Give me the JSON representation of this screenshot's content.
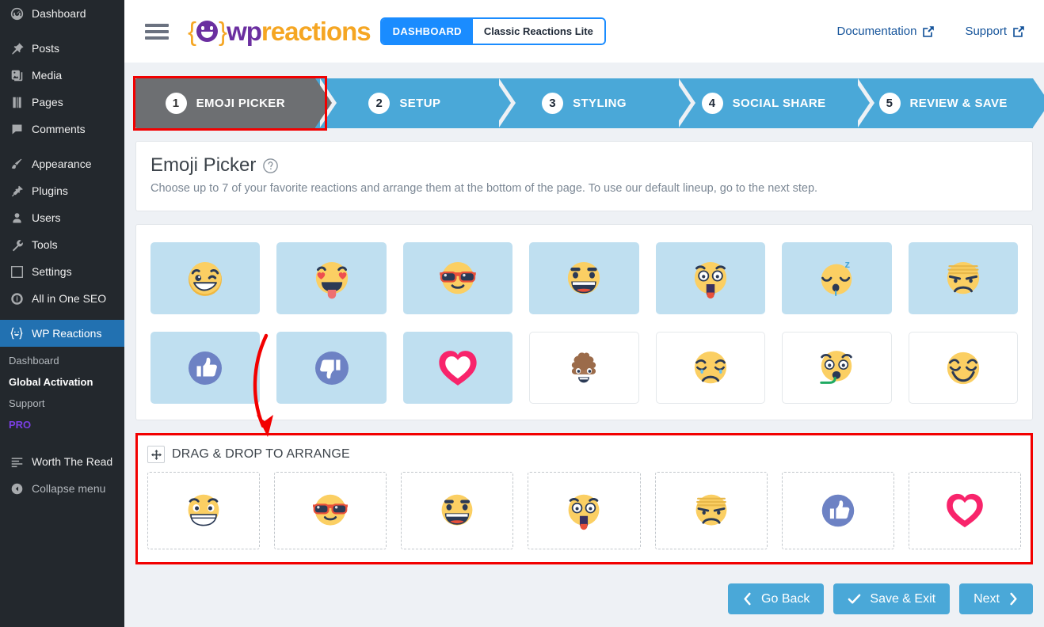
{
  "sidebar": {
    "items": [
      {
        "label": "Dashboard",
        "icon": "dashboard-icon"
      },
      {
        "label": "Posts",
        "icon": "pin-icon"
      },
      {
        "label": "Media",
        "icon": "media-icon"
      },
      {
        "label": "Pages",
        "icon": "pages-icon"
      },
      {
        "label": "Comments",
        "icon": "comments-icon"
      },
      {
        "label": "Appearance",
        "icon": "brush-icon"
      },
      {
        "label": "Plugins",
        "icon": "plug-icon"
      },
      {
        "label": "Users",
        "icon": "user-icon"
      },
      {
        "label": "Tools",
        "icon": "wrench-icon"
      },
      {
        "label": "Settings",
        "icon": "sliders-icon"
      },
      {
        "label": "All in One SEO",
        "icon": "aioseo-icon"
      }
    ],
    "active_item": {
      "label": "WP Reactions",
      "icon": "wp-reactions-smiley-icon"
    },
    "submenu": [
      {
        "label": "Dashboard",
        "state": "normal"
      },
      {
        "label": "Global Activation",
        "state": "current"
      },
      {
        "label": "Support",
        "state": "normal"
      },
      {
        "label": "PRO",
        "state": "pro"
      }
    ],
    "after_items": [
      {
        "label": "Worth The Read",
        "icon": "lines-icon"
      }
    ],
    "collapse": {
      "label": "Collapse menu",
      "icon": "collapse-icon"
    },
    "pro_color": "#7b3fe4",
    "active_color": "#2271b1"
  },
  "topbar": {
    "menu_toggle": "hamburger-icon",
    "logo": {
      "brace_open": "{",
      "brace_close": "}",
      "wp": "wp",
      "reactions": "reactions"
    },
    "mode_tabs": [
      {
        "label": "DASHBOARD",
        "selected": true
      },
      {
        "label": "Classic Reactions Lite",
        "selected": false
      }
    ],
    "links": [
      {
        "label": "Documentation",
        "icon": "external-link-icon"
      },
      {
        "label": "Support",
        "icon": "external-link-icon"
      }
    ],
    "accent_color": "#1a8cff"
  },
  "steps": {
    "items": [
      {
        "number": "1",
        "label": "EMOJI PICKER",
        "active": true
      },
      {
        "number": "2",
        "label": "SETUP",
        "active": false
      },
      {
        "number": "3",
        "label": "STYLING",
        "active": false
      },
      {
        "number": "4",
        "label": "SOCIAL SHARE",
        "active": false
      },
      {
        "number": "5",
        "label": "REVIEW & SAVE",
        "active": false
      }
    ],
    "active_color": "#6d6f72",
    "inactive_color": "#4aa8d8",
    "highlight_color": "#f20000"
  },
  "header": {
    "title": "Emoji Picker",
    "help_icon": "question-circle-icon",
    "description": "Choose up to 7 of your favorite reactions and arrange them at the bottom of the page. To use our default lineup, go to the next step."
  },
  "picker": {
    "selected_bg": "#bfdff0",
    "rows": [
      [
        {
          "name": "wink-grin-emoji",
          "selected": true
        },
        {
          "name": "heart-eyes-tongue-emoji",
          "selected": true
        },
        {
          "name": "sunglasses-cool-emoji",
          "selected": true
        },
        {
          "name": "laughing-emoji",
          "selected": true
        },
        {
          "name": "shocked-emoji",
          "selected": true
        },
        {
          "name": "sleepy-emoji",
          "selected": true
        },
        {
          "name": "angry-sad-emoji",
          "selected": true
        }
      ],
      [
        {
          "name": "thumbs-up-emoji",
          "selected": true
        },
        {
          "name": "thumbs-down-emoji",
          "selected": true
        },
        {
          "name": "heart-emoji",
          "selected": true
        },
        {
          "name": "poop-emoji",
          "selected": false
        },
        {
          "name": "crying-emoji",
          "selected": false
        },
        {
          "name": "vomiting-emoji",
          "selected": false
        },
        {
          "name": "smiling-emoji",
          "selected": false
        }
      ]
    ]
  },
  "arrange": {
    "title": "DRAG & DROP TO ARRANGE",
    "move_icon": "move-arrows-icon",
    "highlight_color": "#f20000",
    "tiles": [
      {
        "name": "grin-emoji"
      },
      {
        "name": "sunglasses-cool-emoji"
      },
      {
        "name": "laughing-emoji"
      },
      {
        "name": "shocked-emoji"
      },
      {
        "name": "angry-sad-emoji"
      },
      {
        "name": "thumbs-up-emoji"
      },
      {
        "name": "heart-emoji"
      }
    ]
  },
  "footer": {
    "buttons": [
      {
        "label": "Go Back",
        "icon": "chevron-left-icon",
        "icon_side": "left"
      },
      {
        "label": "Save & Exit",
        "icon": "check-icon",
        "icon_side": "left"
      },
      {
        "label": "Next",
        "icon": "chevron-right-icon",
        "icon_side": "right"
      }
    ],
    "button_color": "#4aa8d8"
  },
  "annotations": {
    "arrow_color": "#f20000"
  }
}
